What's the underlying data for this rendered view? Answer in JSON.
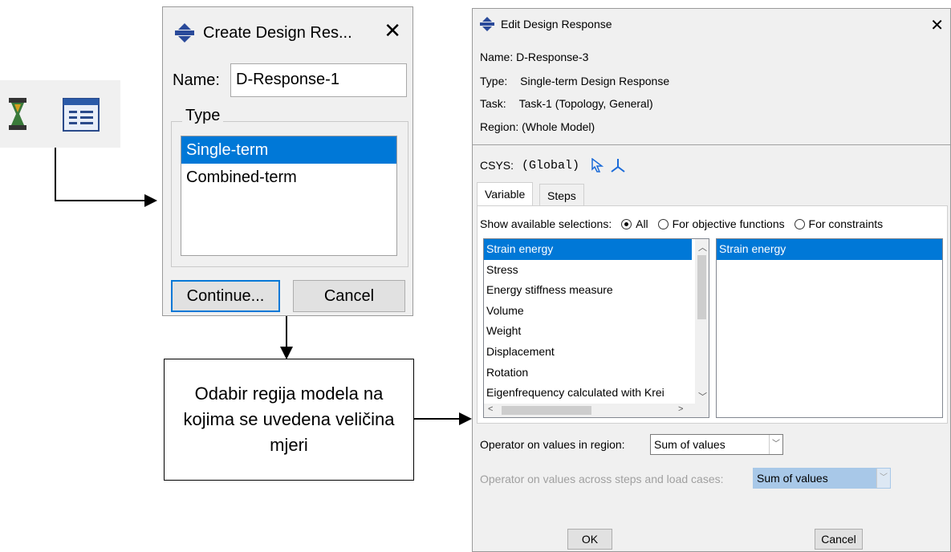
{
  "toolbar": {
    "icons": [
      "design-response-icon",
      "form-icon"
    ]
  },
  "create_dialog": {
    "title": "Create Design Res...",
    "name_label": "Name:",
    "name_value": "D-Response-1",
    "type_group_label": "Type",
    "type_options": [
      "Single-term",
      "Combined-term"
    ],
    "continue_label": "Continue...",
    "cancel_label": "Cancel"
  },
  "callout": {
    "text": "Odabir regija modela na kojima se uvedena veličina mjeri"
  },
  "edit_dialog": {
    "title": "Edit Design Response",
    "name_line": "Name:  D-Response-3",
    "type_label": "Type:",
    "type_value": "Single-term Design Response",
    "task_label": "Task:",
    "task_value": "Task-1 (Topology, General)",
    "region_line": "Region:  (Whole Model)",
    "csys_label": "CSYS:",
    "csys_value": "(Global)",
    "tabs": [
      "Variable",
      "Steps"
    ],
    "show_label": "Show available selections:",
    "radio_options": [
      "All",
      "For objective functions",
      "For constraints"
    ],
    "variables": [
      "Strain energy",
      "Stress",
      "Energy stiffness measure",
      "Volume",
      "Weight",
      "Displacement",
      "Rotation",
      "Eigenfrequency calculated with Krei"
    ],
    "selected_variables": [
      "Strain energy"
    ],
    "operator_region_label": "Operator on values in region:",
    "operator_region_value": "Sum of values",
    "operator_steps_label": "Operator on values across steps and load cases:",
    "operator_steps_value": "Sum of values",
    "ok_label": "OK",
    "cancel_label": "Cancel"
  },
  "colors": {
    "selection": "#0078d7",
    "dialog_bg": "#f0f0f0",
    "disabled_text": "#a0a0a0",
    "disabled_combo": "#a8c8e8"
  }
}
